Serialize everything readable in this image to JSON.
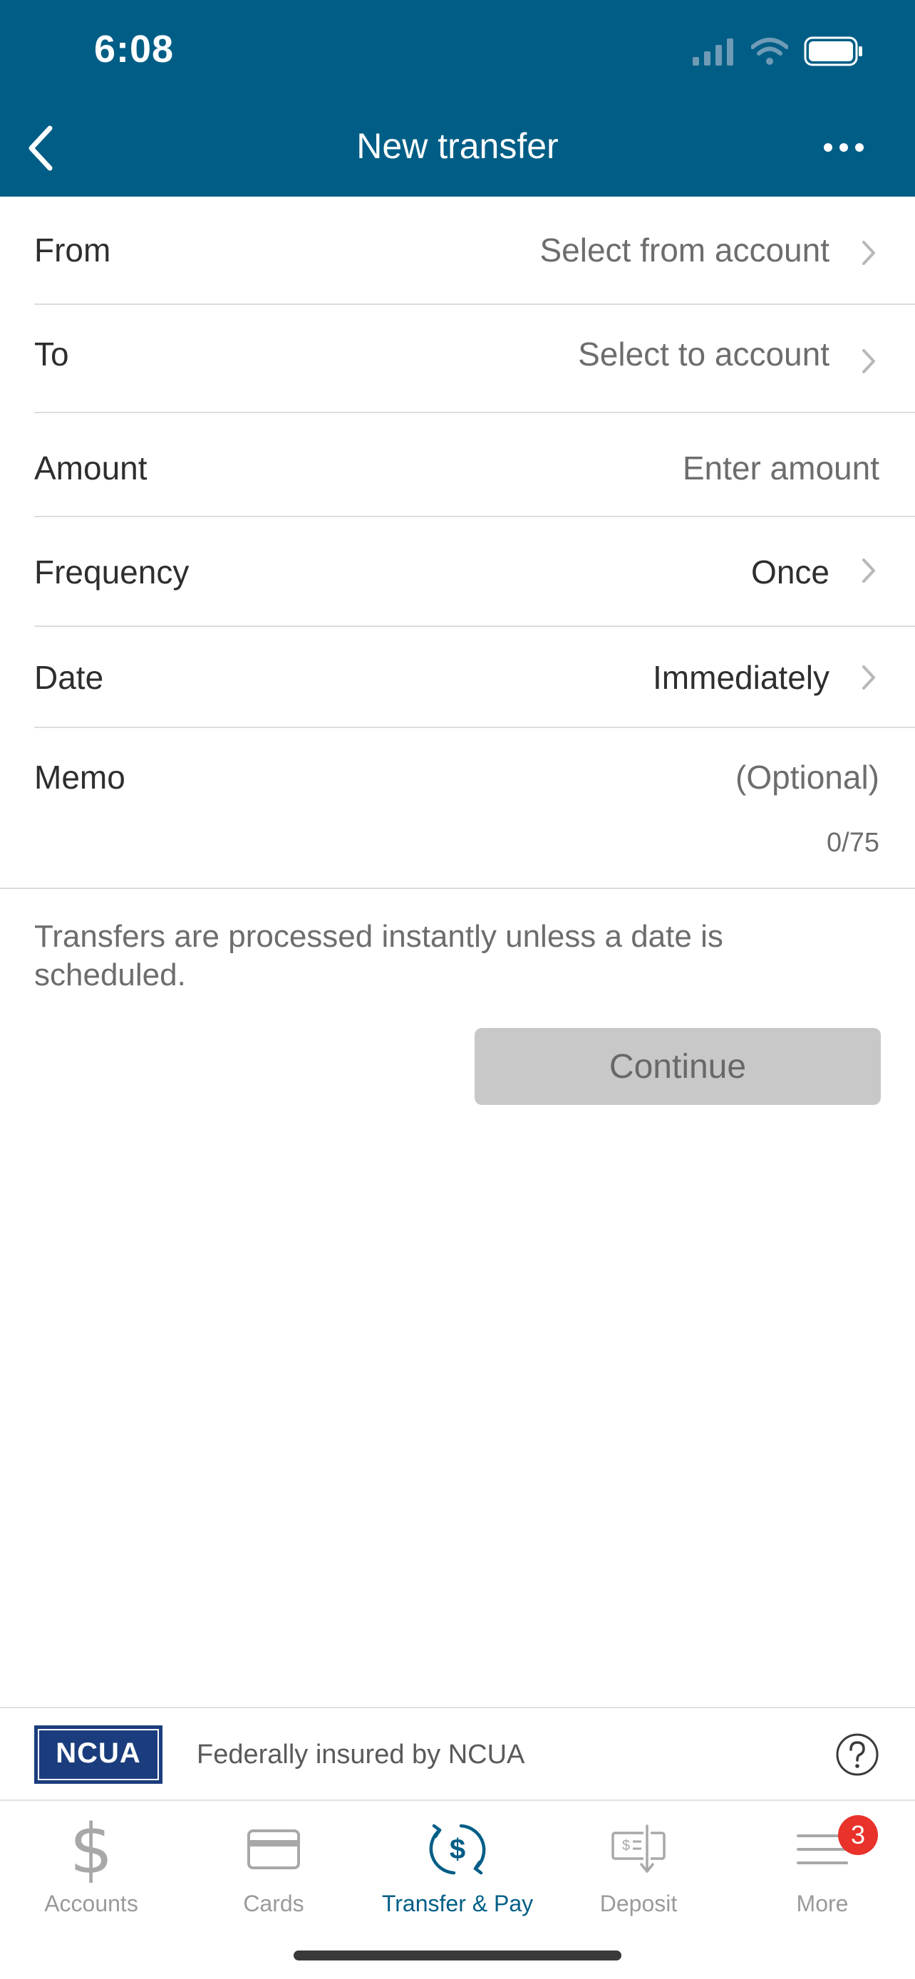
{
  "status_bar": {
    "time": "6:08"
  },
  "nav": {
    "title": "New transfer"
  },
  "form": {
    "from": {
      "label": "From",
      "value": "Select from account"
    },
    "to": {
      "label": "To",
      "value": "Select to account"
    },
    "amount": {
      "label": "Amount",
      "placeholder": "Enter amount"
    },
    "frequency": {
      "label": "Frequency",
      "value": "Once"
    },
    "date": {
      "label": "Date",
      "value": "Immediately"
    },
    "memo": {
      "label": "Memo",
      "placeholder": "(Optional)",
      "counter": "0/75"
    }
  },
  "info_text": "Transfers are processed instantly unless a date is scheduled.",
  "continue_label": "Continue",
  "ncua": {
    "logo_text": "NCUA",
    "text": "Federally insured by NCUA"
  },
  "tabs": [
    {
      "label": "Accounts",
      "icon": "dollar-icon"
    },
    {
      "label": "Cards",
      "icon": "card-icon"
    },
    {
      "label": "Transfer & Pay",
      "icon": "transfer-pay-icon",
      "active": true
    },
    {
      "label": "Deposit",
      "icon": "deposit-check-icon"
    },
    {
      "label": "More",
      "icon": "menu-icon",
      "badge": "3"
    }
  ],
  "colors": {
    "header": "#005e86",
    "accent": "#005e86",
    "badge": "#e8322a",
    "button_disabled": "#c8c8c8"
  }
}
